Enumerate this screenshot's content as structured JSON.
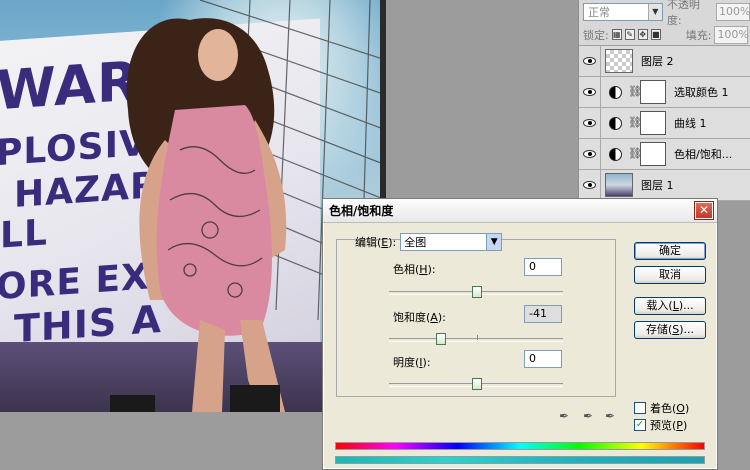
{
  "canvas": {
    "sign_lines": [
      "WARNI",
      "PLOSIV",
      "HAZAR",
      "LL",
      "ORE EXCAVA",
      "THIS A"
    ]
  },
  "layers_panel": {
    "blend_mode": "正常",
    "opacity_label": "不透明度:",
    "opacity_value": "100%",
    "lock_label": "锁定:",
    "fill_label": "填充:",
    "fill_value": "100%",
    "layers": [
      {
        "name": "图层 2",
        "type": "pixel"
      },
      {
        "name": "选取颜色 1",
        "type": "adjustment"
      },
      {
        "name": "曲线 1",
        "type": "adjustment"
      },
      {
        "name": "色相/饱和...",
        "type": "adjustment"
      },
      {
        "name": "图层 1",
        "type": "pixel"
      }
    ]
  },
  "dialog": {
    "title": "色相/饱和度",
    "close_glyph": "✕",
    "edit_label": "编辑(",
    "edit_key": "E",
    "edit_label_end": "):",
    "edit_value": "全图",
    "hue_label": "色相(",
    "hue_key": "H",
    "hue_label_end": "):",
    "hue_value": "0",
    "saturation_label": "饱和度(",
    "saturation_key": "A",
    "saturation_label_end": "):",
    "saturation_value": "-41",
    "lightness_label": "明度(",
    "lightness_key": "I",
    "lightness_label_end": "):",
    "lightness_value": "0",
    "ok_label": "确定",
    "cancel_label": "取消",
    "load_label": "载入(",
    "load_key": "L",
    "load_label_end": ")...",
    "save_label": "存储(",
    "save_key": "S",
    "save_label_end": ")...",
    "colorize_label": "着色(",
    "colorize_key": "O",
    "colorize_label_end": ")",
    "colorize_checked": false,
    "preview_label": "预览(",
    "preview_key": "P",
    "preview_label_end": ")",
    "preview_checked": true,
    "preview_check_glyph": "✓"
  }
}
